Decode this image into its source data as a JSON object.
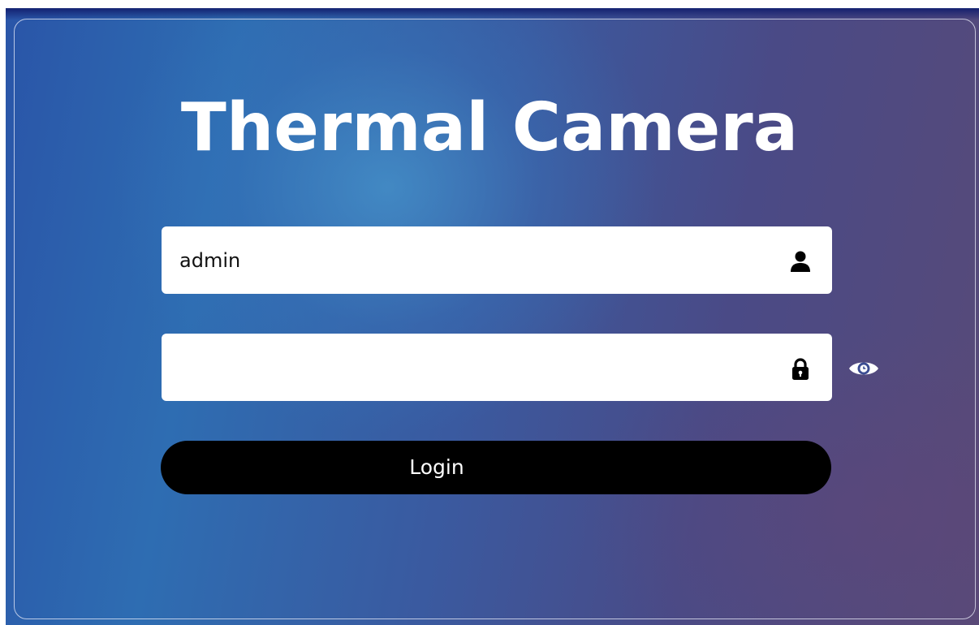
{
  "login_form": {
    "title": "Thermal Camera",
    "username": {
      "value": "admin",
      "placeholder": "",
      "icon": "user-icon"
    },
    "password": {
      "value": "",
      "placeholder": "",
      "icon": "lock-icon",
      "toggle_icon": "eye-icon"
    },
    "submit_label": "Login"
  },
  "colors": {
    "background_start": "#2a55a8",
    "background_end": "#584a78",
    "field_bg": "#ffffff",
    "button_bg": "#000000",
    "text_on_dark": "#ffffff"
  }
}
